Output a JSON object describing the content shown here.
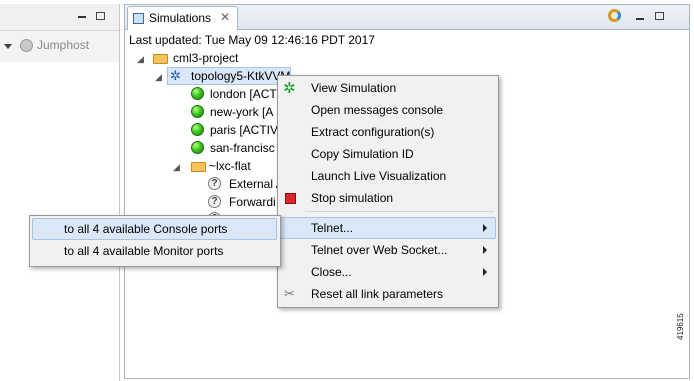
{
  "left_toolbar": {
    "jumphost_label": "Jumphost"
  },
  "tab": {
    "label": "Simulations"
  },
  "status": {
    "last_updated": "Last updated: Tue May 09 12:46:16 PDT 2017"
  },
  "tree": {
    "project": "cml3-project",
    "topology": "topology5-KtkVVM",
    "nodes": [
      "london [ACT",
      "new-york [A",
      "paris [ACTIV",
      "san-francisc"
    ],
    "lxc_folder": "~lxc-flat",
    "lxc_items": [
      "External A",
      "Forwardi"
    ]
  },
  "context_menu": {
    "items": [
      "View Simulation",
      "Open messages console",
      "Extract configuration(s)",
      "Copy Simulation ID",
      "Launch Live Visualization",
      "Stop simulation",
      "Telnet...",
      "Telnet over Web Socket...",
      "Close...",
      "Reset all link parameters"
    ]
  },
  "submenu": {
    "items": [
      "to all 4 available Console ports",
      "to all 4 available Monitor ports"
    ]
  },
  "figure_id": "419615",
  "colors": {
    "highlight": "#d9e7f7",
    "node_active": "#3fc81e",
    "stop_red": "#d9282a"
  }
}
